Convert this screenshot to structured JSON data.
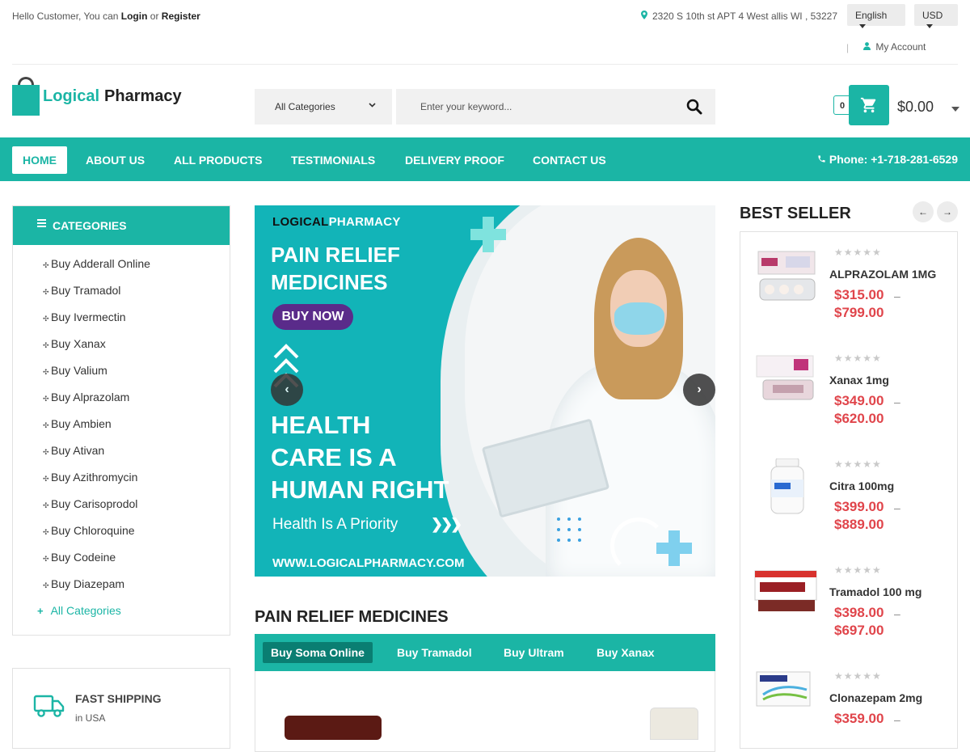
{
  "topbar": {
    "greeting_prefix": "Hello Customer, You can",
    "login": "Login",
    "or": "or",
    "register": "Register",
    "address": "2320 S 10th st APT 4 West allis WI , 53227",
    "language": "English",
    "currency": "USD",
    "separator": "|",
    "account": "My Account"
  },
  "brand": {
    "word1": "Logical",
    "word2": "Pharmacy"
  },
  "search": {
    "category": "All Categories",
    "placeholder": "Enter your keyword..."
  },
  "cart": {
    "count": "0",
    "total": "$0.00"
  },
  "nav": {
    "items": [
      "HOME",
      "ABOUT US",
      "ALL PRODUCTS",
      "TESTIMONIALS",
      "DELIVERY PROOF",
      "CONTACT US"
    ],
    "phone": "Phone: +1-718-281-6529"
  },
  "categories": {
    "title": "CATEGORIES",
    "items": [
      "Buy Adderall Online",
      "Buy Tramadol",
      "Buy Ivermectin",
      "Buy Xanax",
      "Buy Valium",
      "Buy Alprazolam",
      "Buy Ambien",
      "Buy Ativan",
      "Buy Azithromycin",
      "Buy Carisoprodol",
      "Buy Chloroquine",
      "Buy Codeine",
      "Buy Diazepam"
    ],
    "more": "All Categories"
  },
  "shipping": {
    "title": "FAST SHIPPING",
    "subtitle": "in USA"
  },
  "banner": {
    "brand_part1": "LOGICAL",
    "brand_part2": "PHARMACY",
    "headline_1": "PAIN RELIEF",
    "headline_2": "MEDICINES",
    "cta": "BUY NOW",
    "slogan_1": "HEALTH",
    "slogan_2": "CARE IS A",
    "slogan_3": "HUMAN RIGHT",
    "tagline": "Health Is A Priority",
    "url": "WWW.LOGICALPHARMACY.COM"
  },
  "pain_relief": {
    "title": "PAIN RELIEF MEDICINES",
    "tabs": [
      "Buy Soma Online",
      "Buy Tramadol",
      "Buy Ultram",
      "Buy Xanax"
    ]
  },
  "best_seller": {
    "title": "BEST SELLER",
    "products": [
      {
        "name": "ALPRAZOLAM 1MG",
        "price_low": "$315.00",
        "price_high": "$799.00",
        "dash": "–"
      },
      {
        "name": "Xanax 1mg",
        "price_low": "$349.00",
        "price_high": "$620.00",
        "dash": "–"
      },
      {
        "name": "Citra 100mg",
        "price_low": "$399.00",
        "price_high": "$889.00",
        "dash": "–"
      },
      {
        "name": "Tramadol 100 mg",
        "price_low": "$398.00",
        "price_high": "$697.00",
        "dash": "–"
      },
      {
        "name": "Clonazepam 2mg",
        "price_low": "$359.00",
        "price_high": "",
        "dash": "–"
      }
    ],
    "rating": 0
  },
  "colors": {
    "accent": "#1bb5a5",
    "price": "#e0454b",
    "tab_active": "#0a7e72"
  }
}
